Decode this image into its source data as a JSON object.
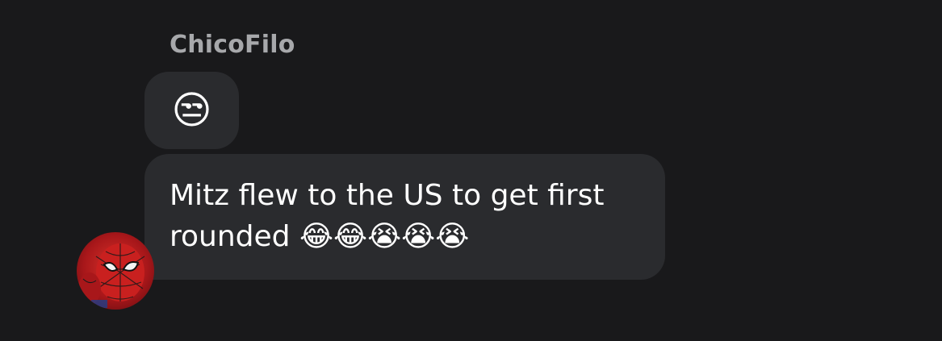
{
  "conversation": {
    "sender_name": "ChicoFilo",
    "messages": [
      {
        "type": "emoji",
        "emoji_name": "unamused-face-emoji",
        "text": "😒"
      },
      {
        "type": "text",
        "lines": [
          "Mitz flew to the US to get first",
          "rounded 😂😂😭😭😭"
        ]
      }
    ],
    "avatar": {
      "icon": "spider-man-avatar",
      "colors": {
        "primary": "#c9201f",
        "dark": "#5a0a0e",
        "web": "#1a1a1a"
      }
    }
  },
  "theme": {
    "background": "#19191b",
    "bubble": "#2a2b2e",
    "sender_name_color": "#a7a8ab",
    "text_color": "#ffffff"
  }
}
